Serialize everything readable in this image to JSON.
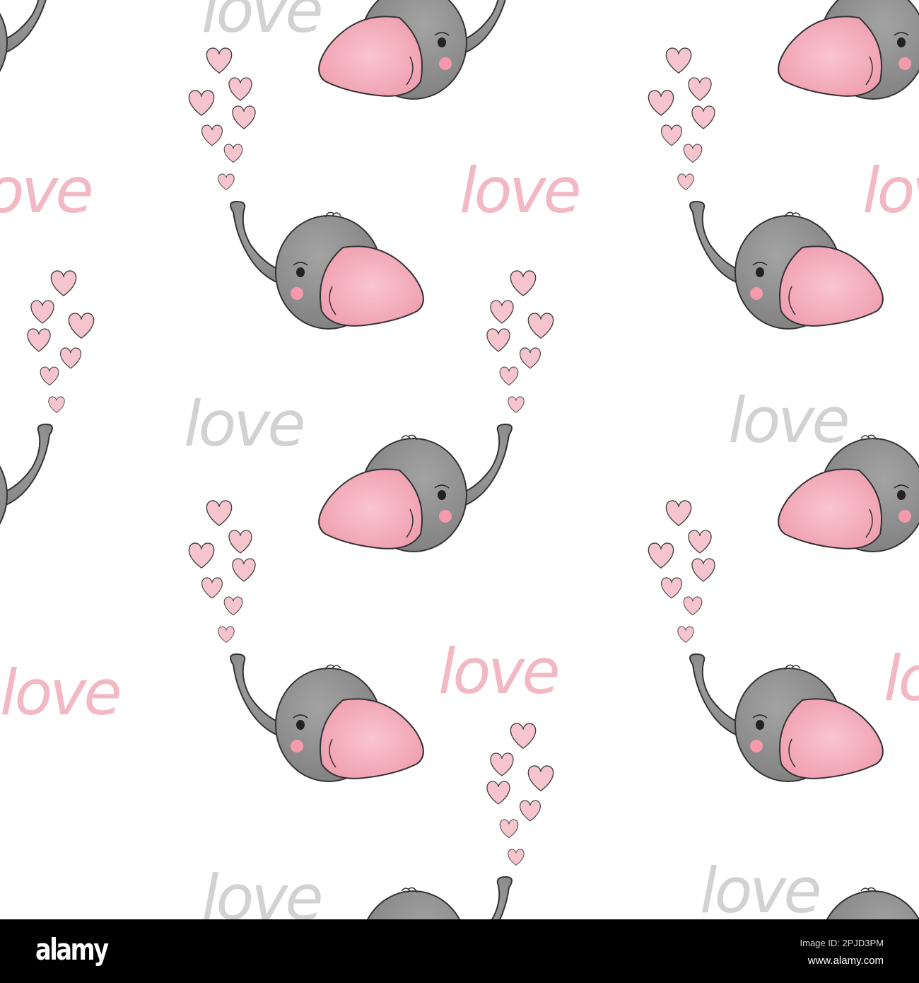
{
  "pattern": {
    "word": "love",
    "colors": {
      "pink": "#f4c3cc",
      "pink_text": "#f2b8c4",
      "gray_text": "#d2d2d2",
      "elephant": "#8e8e8e",
      "ear": "#f2a7b5",
      "outline": "#333333"
    }
  },
  "footer": {
    "brand": "alamy",
    "image_id": "Image ID: 2PJD3PM",
    "url": "www.alamy.com"
  }
}
